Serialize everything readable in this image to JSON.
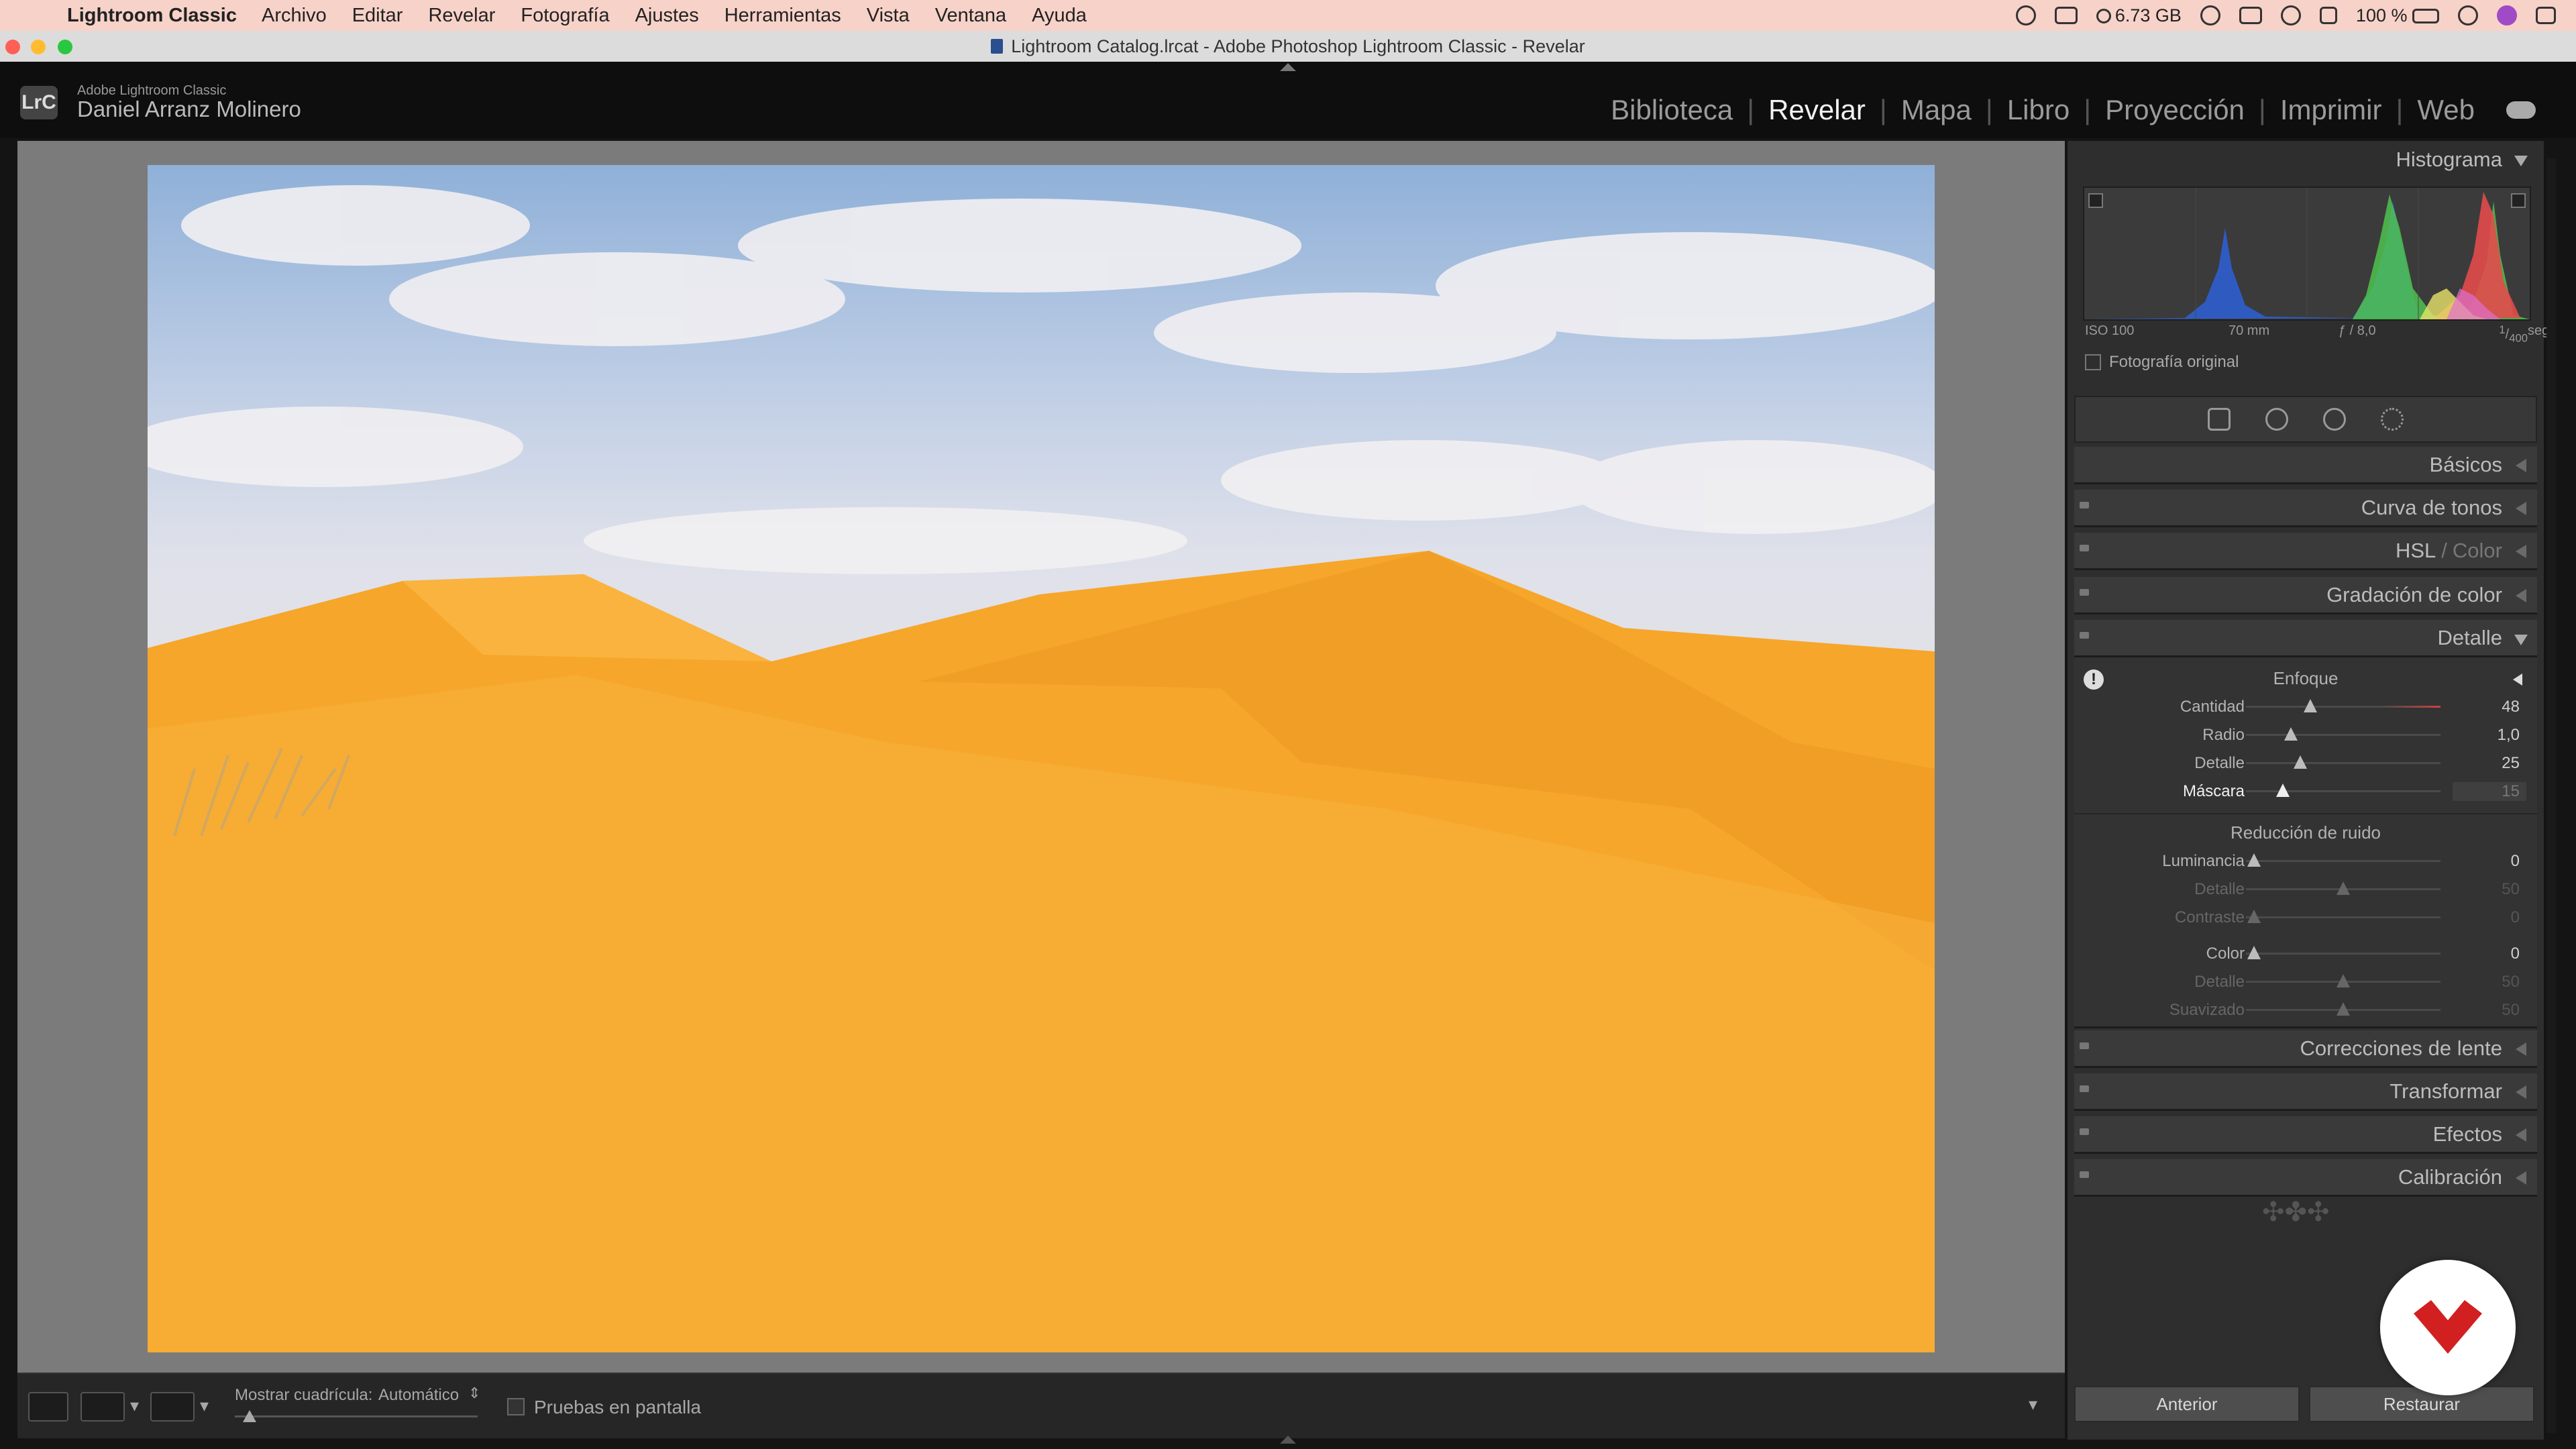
{
  "menubar": {
    "app_name": "Lightroom Classic",
    "items": [
      "Archivo",
      "Editar",
      "Revelar",
      "Fotografía",
      "Ajustes",
      "Herramientas",
      "Vista",
      "Ventana",
      "Ayuda"
    ],
    "memory": "6.73 GB",
    "battery": "100 %"
  },
  "window": {
    "title": "Lightroom Catalog.lrcat - Adobe Photoshop Lightroom Classic - Revelar"
  },
  "identity": {
    "logo": "LrC",
    "product": "Adobe Lightroom Classic",
    "user": "Daniel Arranz Molinero"
  },
  "modules": {
    "items": [
      "Biblioteca",
      "Revelar",
      "Mapa",
      "Libro",
      "Proyección",
      "Imprimir",
      "Web"
    ],
    "active": "Revelar"
  },
  "toolbar": {
    "grid_label": "Mostrar cuadrícula:",
    "grid_value": "Automático",
    "proof_label": "Pruebas en pantalla"
  },
  "histogram": {
    "title": "Histograma",
    "iso": "ISO 100",
    "focal": "70 mm",
    "aperture": "ƒ / 8,0",
    "shutter_num": "1",
    "shutter_den": "400",
    "shutter_unit": "seg.",
    "original_photo": "Fotografía original"
  },
  "panels": {
    "basics": "Básicos",
    "tone_curve": "Curva de tonos",
    "hsl": "HSL",
    "hsl_sep": "/",
    "color": "Color",
    "color_grading": "Gradación de color",
    "detail": "Detalle",
    "lens": "Correcciones de lente",
    "transform": "Transformar",
    "effects": "Efectos",
    "calibration": "Calibración"
  },
  "detail": {
    "sharpening_title": "Enfoque",
    "sharpening": [
      {
        "label": "Cantidad",
        "value": "48",
        "pos": 0.33
      },
      {
        "label": "Radio",
        "value": "1,0",
        "pos": 0.23
      },
      {
        "label": "Detalle",
        "value": "25",
        "pos": 0.28
      },
      {
        "label": "Máscara",
        "value": "15",
        "pos": 0.19
      }
    ],
    "noise_title": "Reducción de ruido",
    "noise": [
      {
        "label": "Luminancia",
        "value": "0",
        "pos": 0.04
      },
      {
        "label": "Detalle",
        "value": "50",
        "pos": 0.5
      },
      {
        "label": "Contraste",
        "value": "0",
        "pos": 0.04
      },
      {
        "label": "Color",
        "value": "0",
        "pos": 0.04
      },
      {
        "label": "Detalle",
        "value": "50",
        "pos": 0.5
      },
      {
        "label": "Suavizado",
        "value": "50",
        "pos": 0.5
      }
    ]
  },
  "buttons": {
    "previous": "Anterior",
    "reset": "Restaurar"
  }
}
